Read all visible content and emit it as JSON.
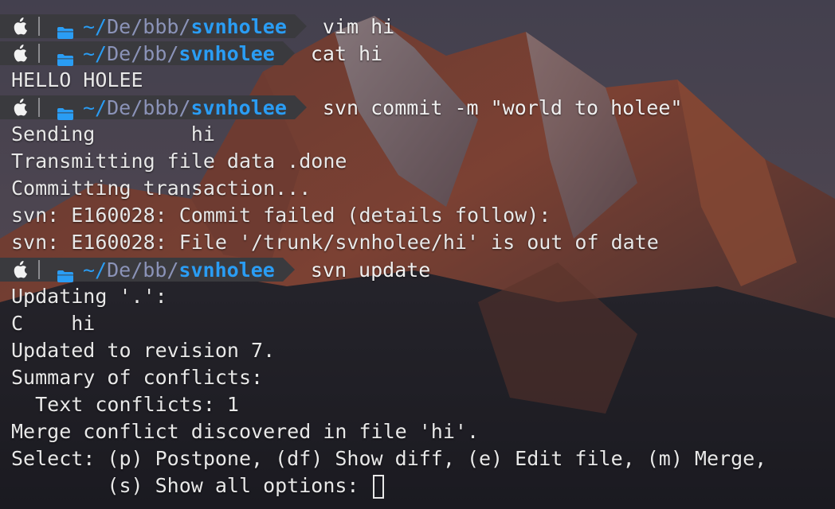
{
  "theme": {
    "prompt_bg": "#3a3a3e",
    "path_accent": "#2a9df4",
    "path_dim": "#8b93b8",
    "text": "#e8e8e8"
  },
  "icons": {
    "os": "apple-icon",
    "folder": "folder-icon"
  },
  "blocks": [
    {
      "type": "prompt",
      "tilde": "~/",
      "mid": "De/bbb/",
      "dir": "svnholee",
      "command": "vim hi"
    },
    {
      "type": "prompt",
      "tilde": "~/",
      "mid": "De/bb/",
      "dir": "svnholee",
      "command": "cat hi"
    },
    {
      "type": "output",
      "text": "HELLO HOLEE"
    },
    {
      "type": "prompt",
      "tilde": "~/",
      "mid": "De/bbb/",
      "dir": "svnholee",
      "command": "svn commit -m \"world to holee\""
    },
    {
      "type": "output",
      "text": "Sending        hi"
    },
    {
      "type": "output",
      "text": "Transmitting file data .done"
    },
    {
      "type": "output",
      "text": "Committing transaction..."
    },
    {
      "type": "output",
      "text": "svn: E160028: Commit failed (details follow):"
    },
    {
      "type": "output",
      "text": "svn: E160028: File '/trunk/svnholee/hi' is out of date"
    },
    {
      "type": "prompt",
      "tilde": "~/",
      "mid": "De/bb/",
      "dir": "svnholee",
      "command": "svn update"
    },
    {
      "type": "output",
      "text": "Updating '.':"
    },
    {
      "type": "output",
      "text": "C    hi"
    },
    {
      "type": "output",
      "text": "Updated to revision 7."
    },
    {
      "type": "output",
      "text": "Summary of conflicts:"
    },
    {
      "type": "output",
      "text": "  Text conflicts: 1"
    },
    {
      "type": "output",
      "text": "Merge conflict discovered in file 'hi'."
    },
    {
      "type": "output",
      "text": "Select: (p) Postpone, (df) Show diff, (e) Edit file, (m) Merge,"
    },
    {
      "type": "input",
      "text": "        (s) Show all options: "
    }
  ]
}
